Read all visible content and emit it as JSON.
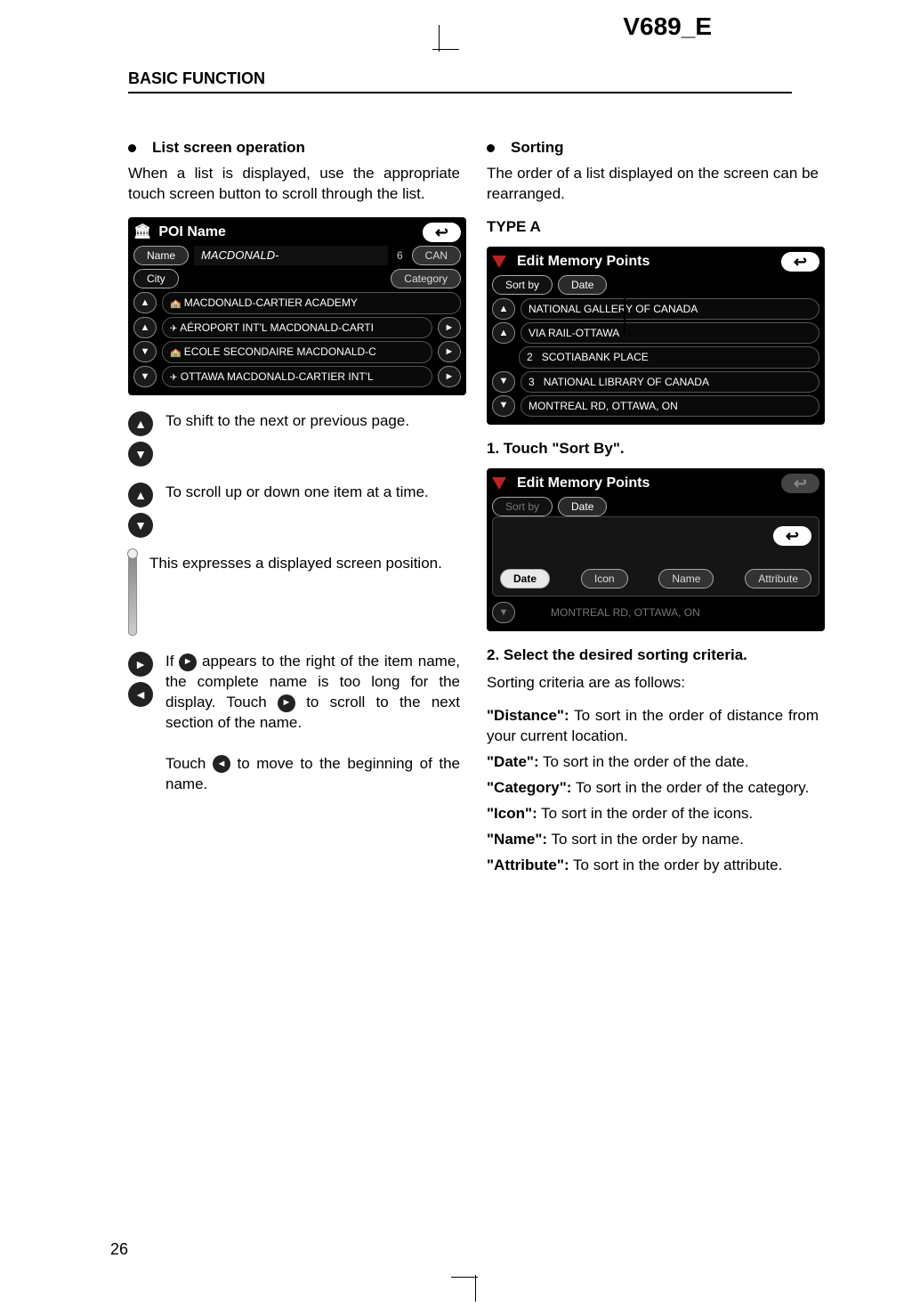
{
  "doc_id": "V689_E",
  "section_header": "BASIC FUNCTION",
  "page_number": "26",
  "left": {
    "bullet_title": "List screen operation",
    "intro": "When a list is displayed, use the appropriate touch screen button to scroll through the list.",
    "screenshot_poi": {
      "title": "POI Name",
      "name_tab": "Name",
      "city_tab": "City",
      "search_value": "MACDONALD-",
      "count": "6",
      "region": "CAN",
      "category_btn": "Category",
      "rows": [
        "MACDONALD-CARTIER ACADEMY",
        "AÉROPORT INT'L MACDONALD-CARTI",
        "ECOLE SECONDAIRE MACDONALD-C",
        "OTTAWA MACDONALD-CARTIER INT'L"
      ],
      "back_glyph": "↩"
    },
    "page_desc": "To shift to the next or previous page.",
    "item_desc": "To scroll up or down one item at a time.",
    "bar_desc": "This expresses a displayed screen position.",
    "arrow_desc_1a": "If ",
    "arrow_desc_1b": " appears to the right of the item name, the complete name is too long for the display. Touch ",
    "arrow_desc_1c": " to scroll to the next section of the name.",
    "arrow_desc_2a": "Touch ",
    "arrow_desc_2b": " to move to the beginning of the name."
  },
  "right": {
    "bullet_title": "Sorting",
    "intro": "The order of a list displayed on the screen can be rearranged.",
    "type_label": "TYPE A",
    "screenshot_edit": {
      "title": "Edit Memory Points",
      "sortby_btn": "Sort by",
      "sortby_value": "Date",
      "rows": [
        {
          "idx": "",
          "text": "NATIONAL GALLERY OF CANADA"
        },
        {
          "idx": "",
          "text": "VIA RAIL-OTTAWA"
        },
        {
          "idx": "2",
          "text": "SCOTIABANK PLACE"
        },
        {
          "idx": "3",
          "text": "NATIONAL LIBRARY OF CANADA"
        },
        {
          "idx": "",
          "text": "MONTREAL RD, OTTAWA, ON"
        }
      ],
      "back_glyph": "↩"
    },
    "step1": "1.   Touch \"Sort By\".",
    "screenshot_sort": {
      "title": "Edit Memory Points",
      "sortby_btn": "Sort by",
      "sortby_value": "Date",
      "options": [
        "Date",
        "Icon",
        "Name",
        "Attribute"
      ],
      "faded_row": "MONTREAL RD, OTTAWA, ON",
      "back_glyph": "↩"
    },
    "step2": "2.   Select the desired sorting criteria.",
    "criteria_intro": "Sorting criteria are as follows:",
    "criteria": [
      {
        "label": "\"Distance\":",
        "text": " To sort in the order of distance from your current location."
      },
      {
        "label": "\"Date\":",
        "text": " To sort in the order of the date."
      },
      {
        "label": "\"Category\":",
        "text": " To sort in the order of the category."
      },
      {
        "label": "\"Icon\":",
        "text": " To sort in the order of the icons."
      },
      {
        "label": "\"Name\":",
        "text": " To sort in the order by name."
      },
      {
        "label": "\"Attribute\":",
        "text": " To sort in the order by attribute."
      }
    ]
  },
  "icons": {
    "page_up": "▲",
    "page_dn": "▼",
    "line_up": "▲",
    "line_dn": "▼",
    "right": "►",
    "left": "◄",
    "bank_icon": "🏛",
    "school_icon": "🏫",
    "plane_icon": "✈"
  }
}
